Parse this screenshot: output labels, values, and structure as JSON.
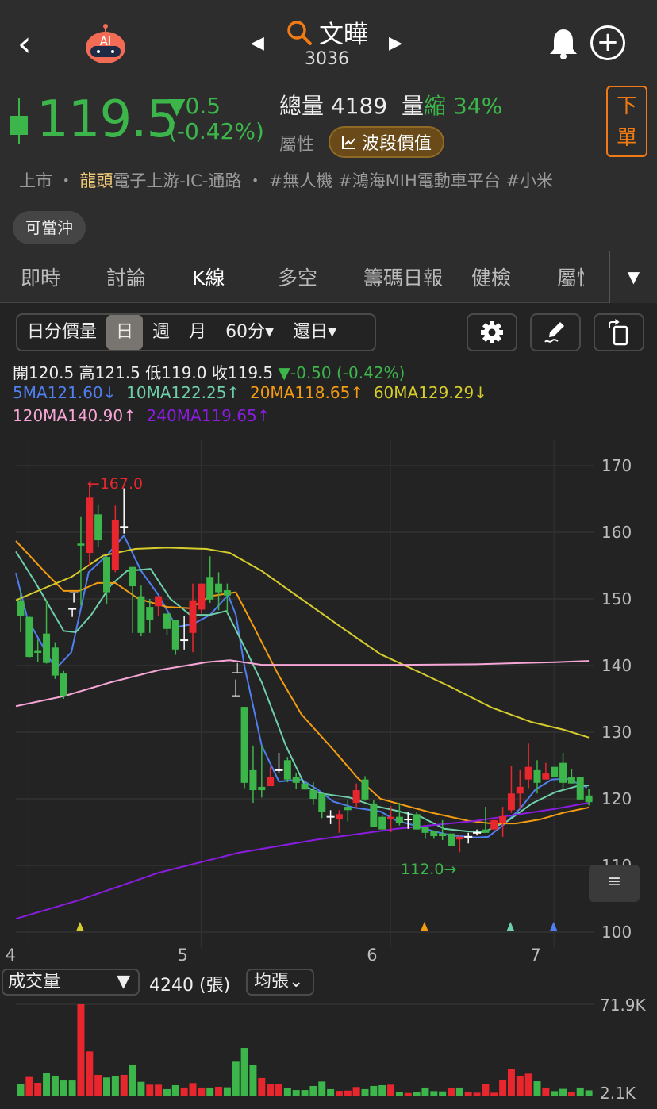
{
  "header": {
    "back": "‹",
    "ai_badge": "AI",
    "prev": "◀",
    "next": "▶",
    "stock_name": "文曄",
    "stock_code": "3036"
  },
  "quote": {
    "price": "119.5",
    "change": "▼0.5",
    "change_pct": "(-0.42%)",
    "total_vol_label": "總量",
    "total_vol": "4189",
    "vol_label": "量",
    "vol_state": "縮",
    "vol_pct": "34%",
    "attr_label": "屬性",
    "wave_button": "波段價值",
    "order_button_1": "下",
    "order_button_2": "單"
  },
  "tags": {
    "market": "上市",
    "dot1": "・",
    "leader": "龍頭",
    "industry": "電子上游-IC-通路",
    "dot2": "・",
    "t1": "#無人機",
    "t2": "#鴻海MIH電動車平台",
    "t3": "#小米"
  },
  "daytrade": "可當沖",
  "tabs": [
    "即時",
    "討論",
    "K線",
    "多空",
    "籌碼日報",
    "健檢",
    "屬性"
  ],
  "tab_more": "▼",
  "periods": {
    "intraday": "日分價量",
    "day": "日",
    "week": "週",
    "month": "月",
    "min60": "60分▾",
    "restore": "還日▾"
  },
  "ohlc": {
    "open": "開120.5",
    "high": "高121.5",
    "low": "低119.0",
    "close": "收119.5",
    "change": "▼-0.50 (-0.42%)"
  },
  "ma_labels": [
    {
      "text": "5MA121.60↓",
      "color": "#4f7ff0"
    },
    {
      "text": "10MA122.25↑",
      "color": "#6fcfab"
    },
    {
      "text": "20MA118.65↑",
      "color": "#f39c12"
    },
    {
      "text": "60MA129.29↓",
      "color": "#d6cc2c"
    },
    {
      "text": "120MA140.90↑",
      "color": "#f6a6d6"
    },
    {
      "text": "240MA119.65↑",
      "color": "#8a1ce0"
    }
  ],
  "chart_data": {
    "type": "candlestick",
    "ylim": [
      100,
      170
    ],
    "yticks": [
      "170",
      "160",
      "150",
      "140",
      "130",
      "120",
      "110",
      "100"
    ],
    "xticks": [
      {
        "label": "4",
        "at": -0.5
      },
      {
        "label": "5",
        "at": 19.5
      },
      {
        "label": "6",
        "at": 41.5
      },
      {
        "label": "7",
        "at": 60.5
      }
    ],
    "x_gridlines": [
      1,
      21,
      43,
      62
    ],
    "annotations": [
      {
        "text": "←167.0",
        "at": 8,
        "price": 167,
        "color": "#e8262e"
      },
      {
        "text": "112.0→",
        "at": 51,
        "price": 112,
        "color": "#3cb54a"
      }
    ],
    "ohlc": [
      [
        149.8,
        151.3,
        145,
        147.4
      ],
      [
        147.3,
        147.5,
        141.2,
        141.3
      ],
      [
        142.2,
        143.9,
        140.6,
        141.9
      ],
      [
        144.8,
        149.8,
        140.3,
        140.4
      ],
      [
        142.7,
        143.5,
        138,
        138.5
      ],
      [
        138.8,
        139.2,
        135,
        135.4
      ],
      [
        148.5,
        148.5,
        147.3,
        148.5
      ],
      [
        158.3,
        162.3,
        149,
        158
      ],
      [
        156.9,
        167,
        154.9,
        165.2
      ],
      [
        162.7,
        164.2,
        157.8,
        158.8
      ],
      [
        156.3,
        156.3,
        149.3,
        151
      ],
      [
        154.4,
        164,
        154,
        161.8
      ],
      [
        160.8,
        166.6,
        159.8,
        160.8
      ],
      [
        154.8,
        154.8,
        144.9,
        151.9
      ],
      [
        150.4,
        152,
        144.4,
        144.9
      ],
      [
        148.8,
        150,
        144.9,
        146.9
      ],
      [
        148.9,
        150.4,
        147.4,
        150.4
      ],
      [
        147.8,
        147.8,
        144.6,
        145.5
      ],
      [
        146.8,
        146.8,
        141.6,
        142.4
      ],
      [
        143.8,
        147.4,
        142.4,
        143.8
      ],
      [
        144.9,
        152.3,
        142,
        149.8
      ],
      [
        148.4,
        152.3,
        147.8,
        152.3
      ],
      [
        153.3,
        156.4,
        149.4,
        149.9
      ],
      [
        152.3,
        154,
        148.3,
        151
      ],
      [
        151.3,
        152.3,
        147.8,
        150.5
      ],
      [
        135.4,
        137.9,
        135.4,
        135.4
      ],
      [
        133.8,
        133.8,
        121.6,
        122.4
      ],
      [
        124.3,
        128,
        119.4,
        121.3
      ],
      [
        121.8,
        128,
        120.2,
        121.3
      ],
      [
        121.9,
        124.8,
        121.9,
        123.3
      ],
      [
        124.3,
        126.9,
        123.8,
        124.3
      ],
      [
        125.8,
        126.3,
        122.5,
        122.9
      ],
      [
        123.3,
        123.9,
        121.5,
        122.4
      ],
      [
        122.3,
        122.3,
        121.4,
        121.4
      ],
      [
        121.3,
        122.5,
        119.1,
        120
      ],
      [
        120.8,
        120.8,
        117.1,
        118
      ],
      [
        117.3,
        118.3,
        116.2,
        117.3
      ],
      [
        116.9,
        118.3,
        114.9,
        117.7
      ],
      [
        118.8,
        119.9,
        116.6,
        118.3
      ],
      [
        119.4,
        122.3,
        118.7,
        121.3
      ],
      [
        122.9,
        123.4,
        119.7,
        119.9
      ],
      [
        119.3,
        119.8,
        115.8,
        115.8
      ],
      [
        117.3,
        117.6,
        115.4,
        115.4
      ],
      [
        116.9,
        118.9,
        115,
        117.3
      ],
      [
        117.3,
        119.4,
        116,
        116.4
      ],
      [
        116.9,
        118,
        115.5,
        116.9
      ],
      [
        117.7,
        118,
        115.4,
        115.4
      ],
      [
        115.8,
        115.8,
        114,
        114.9
      ],
      [
        115.2,
        115.2,
        114,
        114.4
      ],
      [
        114.8,
        116.8,
        113.8,
        114.4
      ],
      [
        114.8,
        114.8,
        112.9,
        112.9
      ],
      [
        113.9,
        114.6,
        112,
        114.3
      ],
      [
        114.3,
        114.9,
        113.3,
        114.3
      ],
      [
        114.9,
        115.4,
        114.5,
        114.9
      ],
      [
        115.4,
        118.8,
        114.9,
        114.9
      ],
      [
        115.4,
        116.8,
        115.2,
        116.8
      ],
      [
        116.4,
        118.8,
        114.3,
        117.4
      ],
      [
        118.3,
        124.9,
        117.9,
        120.8
      ],
      [
        120.8,
        124.3,
        118.5,
        121.8
      ],
      [
        122.9,
        128.3,
        121.6,
        124.8
      ],
      [
        124.3,
        125.8,
        120.8,
        122.4
      ],
      [
        122.9,
        125.4,
        122.9,
        123.8
      ],
      [
        124.8,
        124.8,
        123.3,
        123.3
      ],
      [
        125.4,
        126.9,
        121.4,
        122.4
      ],
      [
        123.3,
        124.4,
        122.3,
        122.3
      ],
      [
        123.3,
        123.3,
        119.9,
        119.9
      ],
      [
        120.5,
        121.5,
        119,
        119.5
      ]
    ],
    "ma_series": [
      {
        "name": "5MA",
        "color": "#4f7ff0",
        "points": [
          [
            -0.55,
            153.9
          ],
          [
            0.8,
            147
          ],
          [
            4.05,
            139.5
          ],
          [
            5.9,
            142
          ],
          [
            7.9,
            154
          ],
          [
            10,
            156.5
          ],
          [
            12,
            159.5
          ],
          [
            14,
            154.2
          ],
          [
            16,
            150.6
          ],
          [
            18.1,
            145.8
          ],
          [
            20,
            146.2
          ],
          [
            22,
            147.6
          ],
          [
            24.1,
            150.6
          ],
          [
            25,
            147.6
          ],
          [
            26,
            139.9
          ],
          [
            28,
            128
          ],
          [
            30,
            122.6
          ],
          [
            32.6,
            122.9
          ],
          [
            34.5,
            121.4
          ],
          [
            36.3,
            119.6
          ],
          [
            38.6,
            118.7
          ],
          [
            41.8,
            118.1
          ],
          [
            43.7,
            116.7
          ],
          [
            45.5,
            116.1
          ],
          [
            47.8,
            115.2
          ],
          [
            50.1,
            114.5
          ],
          [
            52.9,
            114.2
          ],
          [
            54.3,
            114.3
          ],
          [
            56.1,
            116.1
          ],
          [
            58,
            118.5
          ],
          [
            59.8,
            121.4
          ],
          [
            61.7,
            122.9
          ],
          [
            63.5,
            123
          ],
          [
            65.8,
            121.7
          ]
        ]
      },
      {
        "name": "10MA",
        "color": "#6fcfab",
        "points": [
          [
            -0.55,
            157.1
          ],
          [
            1.75,
            152.4
          ],
          [
            5,
            145.2
          ],
          [
            6.4,
            145
          ],
          [
            8.2,
            147.6
          ],
          [
            10.5,
            152.1
          ],
          [
            12.35,
            154.2
          ],
          [
            15.1,
            154.5
          ],
          [
            17.4,
            150
          ],
          [
            19.7,
            147.6
          ],
          [
            22,
            147.6
          ],
          [
            23.9,
            148.2
          ],
          [
            25.3,
            144.6
          ],
          [
            28,
            137.5
          ],
          [
            30.8,
            128
          ],
          [
            33.1,
            121.8
          ],
          [
            34.9,
            120.8
          ],
          [
            38.2,
            120.2
          ],
          [
            40.9,
            119
          ],
          [
            43.7,
            118.2
          ],
          [
            46.5,
            117.3
          ],
          [
            49.2,
            115.5
          ],
          [
            52,
            115.1
          ],
          [
            53.8,
            115
          ],
          [
            56.6,
            116.7
          ],
          [
            59.4,
            119.3
          ],
          [
            62.1,
            121
          ],
          [
            64.9,
            122
          ],
          [
            66,
            122
          ]
        ]
      },
      {
        "name": "20MA",
        "color": "#f39c12",
        "points": [
          [
            -0.55,
            158.7
          ],
          [
            2.7,
            154.2
          ],
          [
            5,
            151.2
          ],
          [
            6.8,
            151.2
          ],
          [
            8.9,
            152.4
          ],
          [
            11,
            152.4
          ],
          [
            13.7,
            150
          ],
          [
            17,
            148.8
          ],
          [
            19.7,
            148.6
          ],
          [
            22,
            150.4
          ],
          [
            25,
            151
          ],
          [
            27.1,
            145.8
          ],
          [
            29.9,
            138.7
          ],
          [
            32.6,
            132.7
          ],
          [
            36.3,
            127.4
          ],
          [
            39.1,
            123.2
          ],
          [
            41.8,
            120
          ],
          [
            44.6,
            119
          ],
          [
            47.8,
            117.9
          ],
          [
            52,
            116.7
          ],
          [
            54.7,
            116.3
          ],
          [
            57.5,
            116.3
          ],
          [
            60.3,
            116.9
          ],
          [
            63,
            117.9
          ],
          [
            66,
            118.7
          ]
        ]
      },
      {
        "name": "60MA",
        "color": "#d6cc2c",
        "points": [
          [
            -0.55,
            149.8
          ],
          [
            3.1,
            151.8
          ],
          [
            5.9,
            153.3
          ],
          [
            9.6,
            156.5
          ],
          [
            13.3,
            157.5
          ],
          [
            17,
            157.7
          ],
          [
            21.6,
            157.5
          ],
          [
            24.3,
            156.9
          ],
          [
            28,
            154.2
          ],
          [
            32.6,
            150
          ],
          [
            37.2,
            145.8
          ],
          [
            41.8,
            141.7
          ],
          [
            46.5,
            138.9
          ],
          [
            50.1,
            136.7
          ],
          [
            54.7,
            133.7
          ],
          [
            59.4,
            131.5
          ],
          [
            63,
            130.4
          ],
          [
            66,
            129.2
          ]
        ]
      },
      {
        "name": "120MA",
        "color": "#f6a6d6",
        "points": [
          [
            -0.55,
            133.9
          ],
          [
            5,
            135.4
          ],
          [
            10.5,
            137.5
          ],
          [
            16,
            139.3
          ],
          [
            21.6,
            140.5
          ],
          [
            24.3,
            140.8
          ],
          [
            28,
            140.1
          ],
          [
            34.5,
            140.1
          ],
          [
            43.7,
            140.1
          ],
          [
            52.9,
            140.2
          ],
          [
            62.1,
            140.5
          ],
          [
            66,
            140.7
          ]
        ]
      },
      {
        "name": "240MA",
        "color": "#8a1ce0",
        "points": [
          [
            -0.55,
            102
          ],
          [
            6.8,
            104.8
          ],
          [
            16,
            108.9
          ],
          [
            25.3,
            111.9
          ],
          [
            34.5,
            113.9
          ],
          [
            43.7,
            115.5
          ],
          [
            52.9,
            116.7
          ],
          [
            62.1,
            118.5
          ],
          [
            66,
            119.4
          ]
        ]
      }
    ],
    "signals": [
      {
        "at": 6.9,
        "color": "#d6cc2c"
      },
      {
        "at": 46.9,
        "color": "#f39c12"
      },
      {
        "at": 56.9,
        "color": "#6fcfab"
      },
      {
        "at": 61.9,
        "color": "#4f7ff0"
      }
    ],
    "doji_marks": [
      {
        "at": 6,
        "glyph": "T"
      },
      {
        "at": 25,
        "glyph": "⊥"
      }
    ]
  },
  "side_button": "≡",
  "volume": {
    "selector": "成交量",
    "selector_arrow": "▼",
    "value": "4240 (張)",
    "unit_button": "均張⌄",
    "ylabels": [
      "71.9K",
      "2.1K"
    ],
    "ymax": 71.9,
    "ymin": 2.1,
    "values": [
      10.6,
      16.3,
      11.8,
      19.1,
      17.3,
      13.6,
      13.6,
      71.9,
      35.9,
      17.9,
      15.9,
      16.7,
      17.9,
      25.8,
      12.6,
      10.4,
      10.4,
      7.0,
      10.0,
      8.2,
      11.6,
      8.2,
      8.2,
      8.8,
      8.4,
      28.0,
      38.5,
      25.4,
      15.5,
      10.6,
      10.6,
      8.0,
      6.3,
      6.3,
      9.4,
      12.8,
      7.0,
      5.7,
      5.9,
      8.6,
      7.0,
      9.4,
      10.0,
      10.4,
      5.1,
      4.1,
      5.1,
      8.2,
      5.5,
      5.3,
      7.6,
      8.2,
      5.1,
      4.3,
      11.2,
      4.3,
      14.0,
      22.3,
      17.3,
      18.9,
      13.0,
      8.2,
      5.5,
      7.2,
      4.5,
      8.2,
      6.1
    ],
    "up": "grrggggrrrggrggrrggrrrgrggggrrrggggggrrrgggrgrggggrgrrrrrrrrgrggrgg"
  },
  "colors": {
    "up": "#e8262e",
    "down": "#3cb54a",
    "flat": "#ffffff",
    "accent": "#f07b14"
  }
}
